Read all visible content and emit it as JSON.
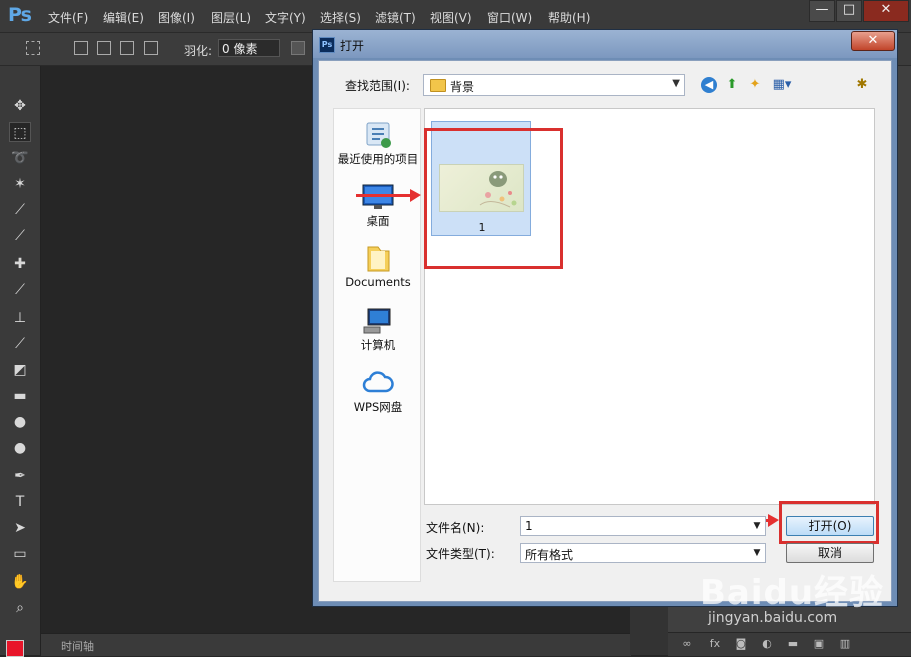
{
  "app": {
    "logo": "Ps",
    "menu": [
      "文件(F)",
      "编辑(E)",
      "图像(I)",
      "图层(L)",
      "文字(Y)",
      "选择(S)",
      "滤镜(T)",
      "视图(V)",
      "窗口(W)",
      "帮助(H)"
    ],
    "window_controls": {
      "minimize": "—",
      "maximize": "□",
      "close": "✕"
    }
  },
  "options_bar": {
    "feather_label": "羽化:",
    "feather_value": "0 像素"
  },
  "toolbox": {
    "tools": [
      "move-tool",
      "marquee-tool",
      "lasso-tool",
      "magic-wand-tool",
      "crop-tool",
      "eyedropper-tool",
      "healing-tool",
      "brush-tool",
      "stamp-tool",
      "history-brush-tool",
      "eraser-tool",
      "gradient-tool",
      "blur-tool",
      "dodge-tool",
      "pen-tool",
      "type-tool",
      "path-select-tool",
      "shape-tool",
      "hand-tool",
      "zoom-tool"
    ],
    "foreground_color": "#e8152a"
  },
  "timeline": {
    "label": "时间轴"
  },
  "dialog": {
    "title": "打开",
    "app_icon": "Ps",
    "lookin_label": "查找范围(I):",
    "lookin_value": "背景",
    "places": [
      {
        "label": "最近使用的项目",
        "icon": "recent-items-icon"
      },
      {
        "label": "桌面",
        "icon": "desktop-icon"
      },
      {
        "label": "Documents",
        "icon": "documents-folder-icon"
      },
      {
        "label": "计算机",
        "icon": "computer-icon"
      },
      {
        "label": "WPS网盘",
        "icon": "cloud-icon"
      }
    ],
    "files": [
      {
        "name": "1",
        "selected": true
      }
    ],
    "filename_label": "文件名(N):",
    "filename_value": "1",
    "filetype_label": "文件类型(T):",
    "filetype_value": "所有格式",
    "open_button": "打开(O)",
    "cancel_button": "取消",
    "annotation_color": "#d9302e"
  },
  "watermark": {
    "text": "Baidu经验",
    "url": "jingyan.baidu.com"
  }
}
